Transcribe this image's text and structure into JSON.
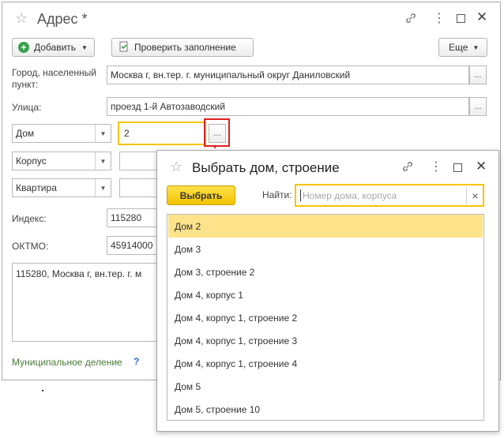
{
  "address_form": {
    "title": "Адрес *",
    "toolbar": {
      "add": "Добавить",
      "check": "Проверить заполнение",
      "more": "Еще"
    },
    "city_label": "Город, населенный пункт:",
    "city_value": "Москва г, вн.тер. г. муниципальный округ Даниловский",
    "street_label": "Улица:",
    "street_value": "проезд 1-й Автозаводский",
    "house_type": "Дом",
    "house_value": "2",
    "korpus_type": "Корпус",
    "kvartira_type": "Квартира",
    "index_label": "Индекс:",
    "index_value": "115280",
    "oktmo_label": "ОКТМО:",
    "oktmo_value": "45914000",
    "full_address": "115280, Москва г, вн.тер. г. м",
    "municipal_link": "Муниципальное деление",
    "help": "?",
    "ellipsis": "..."
  },
  "picker": {
    "title": "Выбрать дом, строение",
    "select_button": "Выбрать",
    "find_label": "Найти:",
    "search_placeholder": "Номер дома, корпуса",
    "clear": "×",
    "items": [
      "Дом 2",
      "Дом 3",
      "Дом 3, строение 2",
      "Дом 4, корпус 1",
      "Дом 4, корпус 1, строение 2",
      "Дом 4, корпус 1, строение 3",
      "Дом 4, корпус 1, строение 4",
      "Дом 5",
      "Дом 5, строение 10"
    ],
    "selected_index": 0
  },
  "colors": {
    "highlight": "#ffe38a",
    "accent": "#f5c400",
    "callout": "#e02020",
    "link": "#4a7a3a"
  }
}
